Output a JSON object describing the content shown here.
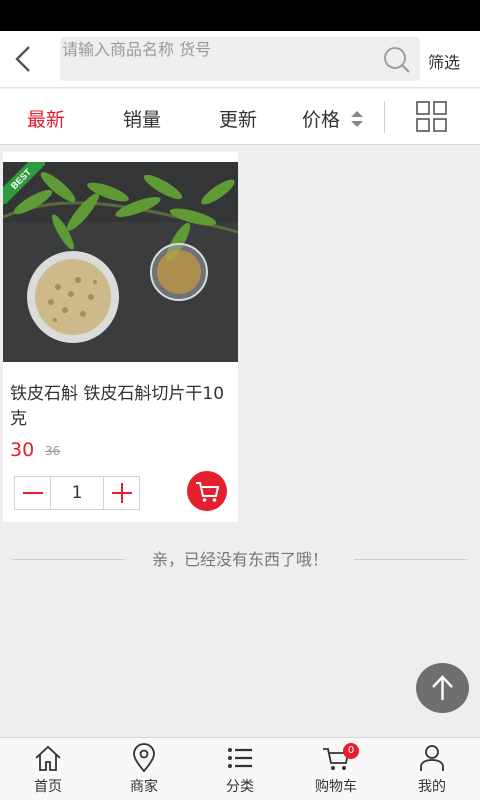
{
  "search": {
    "placeholder": "请输入商品名称 货号",
    "filter_label": "筛选"
  },
  "sort_tabs": [
    {
      "label": "最新",
      "active": true
    },
    {
      "label": "销量",
      "active": false
    },
    {
      "label": "更新",
      "active": false
    },
    {
      "label": "价格",
      "active": false
    }
  ],
  "product": {
    "badge": "BEST",
    "name": "铁皮石斛 铁皮石斛切片干10克",
    "price": "30",
    "old_price": "36",
    "quantity": "1"
  },
  "end_message": "亲，已经没有东西了哦！",
  "tabbar": {
    "items": [
      {
        "label": "首页",
        "icon": "home-icon"
      },
      {
        "label": "商家",
        "icon": "location-pin-icon"
      },
      {
        "label": "分类",
        "icon": "list-icon"
      },
      {
        "label": "购物车",
        "icon": "cart-icon"
      },
      {
        "label": "我的",
        "icon": "user-icon"
      }
    ],
    "cart_badge": "0"
  },
  "colors": {
    "accent": "#e4202e",
    "badge_green": "#2f9a3e"
  }
}
